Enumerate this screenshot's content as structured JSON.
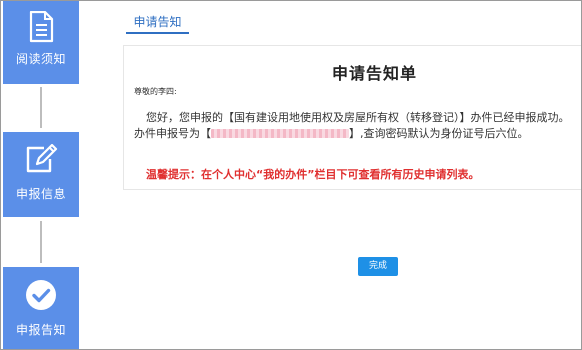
{
  "steps": [
    {
      "label": "阅读须知",
      "icon": "document-icon"
    },
    {
      "label": "申报信息",
      "icon": "edit-icon"
    },
    {
      "label": "申报告知",
      "icon": "check-circle-icon"
    }
  ],
  "tab": {
    "label": "申请告知"
  },
  "notice": {
    "title": "申请告知单",
    "greeting": "尊敬的李四:",
    "line1": "您好，您申报的【国有建设用地使用权及房屋所有权（转移登记）】办件已经申报成功。",
    "line2_prefix": "办件申报号为【",
    "line2_suffix": "】,查询密码默认为身份证号后六位。",
    "tip": "温馨提示：在个人中心“我的办件”栏目下可查看所有历史申请列表。"
  },
  "finish_button": {
    "label": "完成"
  },
  "colors": {
    "step_bg": "#5b8fe8",
    "tab_accent": "#2f6fc2",
    "tip_red": "#e03030",
    "button_blue": "#1e90e6"
  }
}
